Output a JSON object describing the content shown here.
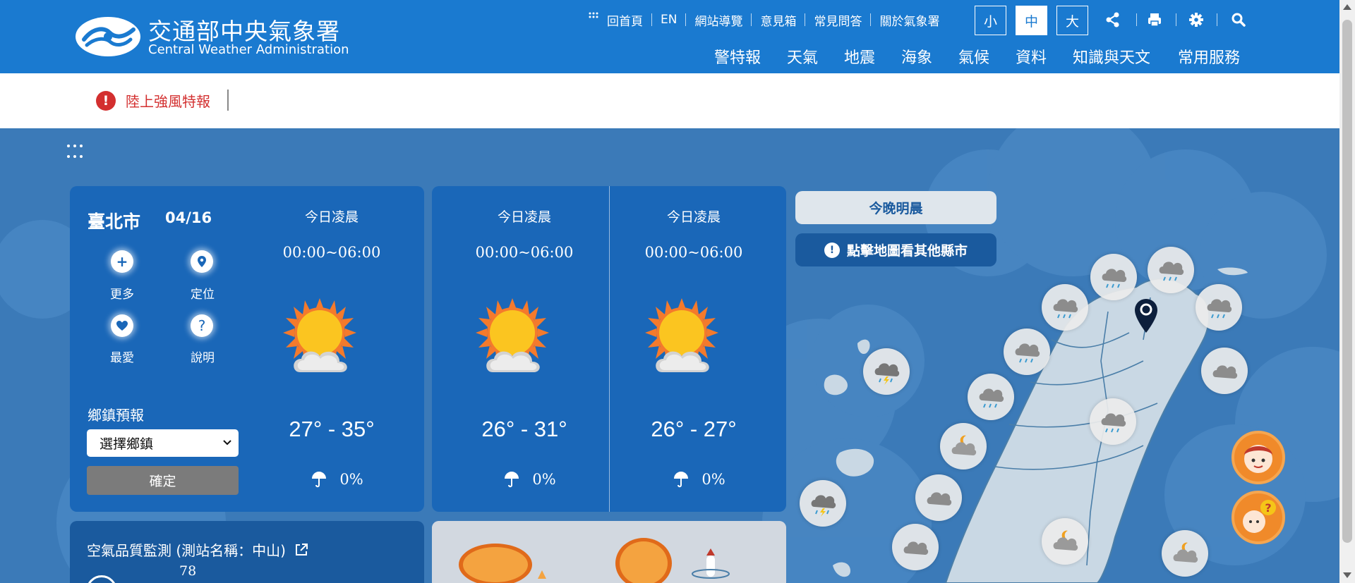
{
  "header": {
    "logo_zh": "交通部中央氣象署",
    "logo_en": "Central Weather Administration",
    "util_nav": [
      "回首頁",
      "EN",
      "網站導覽",
      "意見箱",
      "常見問答",
      "關於氣象署"
    ],
    "font_sizes": [
      "小",
      "中",
      "大"
    ],
    "active_font_size": "中",
    "tool_icons": [
      "share-icon",
      "print-icon",
      "gear-icon",
      "search-icon"
    ],
    "main_nav": [
      "警特報",
      "天氣",
      "地震",
      "海象",
      "氣候",
      "資料",
      "知識與天文",
      "常用服務"
    ]
  },
  "alert": {
    "text": "陸上強風特報"
  },
  "forecast": {
    "city": "臺北市",
    "date": "04/16",
    "quick_actions": [
      {
        "label": "更多",
        "icon": "plus-icon"
      },
      {
        "label": "定位",
        "icon": "location-pin-icon"
      },
      {
        "label": "最愛",
        "icon": "heart-icon"
      },
      {
        "label": "說明",
        "icon": "help-icon"
      }
    ],
    "town_label": "鄉鎮預報",
    "town_select_value": "選擇鄉鎮",
    "confirm_label": "確定",
    "periods": [
      {
        "period": "今日凌晨",
        "time": "00:00~06:00",
        "temp": "27° - 35°",
        "rain": "0%",
        "icon": "sunny-cloud-icon"
      },
      {
        "period": "今日凌晨",
        "time": "00:00~06:00",
        "temp": "26° - 31°",
        "rain": "0%",
        "icon": "sunny-cloud-icon"
      },
      {
        "period": "今日凌晨",
        "time": "00:00~06:00",
        "temp": "26° - 27°",
        "rain": "0%",
        "icon": "sunny-cloud-icon"
      }
    ]
  },
  "map": {
    "tonight_label": "今晚明晨",
    "other_counties_label": "點擊地圖看其他縣市"
  },
  "air_quality": {
    "title": "空氣品質監測 (測站名稱：中山)",
    "value": "78"
  },
  "colors": {
    "header_blue": "#1a7ad0",
    "card_blue": "#1a67b8",
    "alert_red": "#d32f2f",
    "map_bg": "#3b7ab8"
  }
}
